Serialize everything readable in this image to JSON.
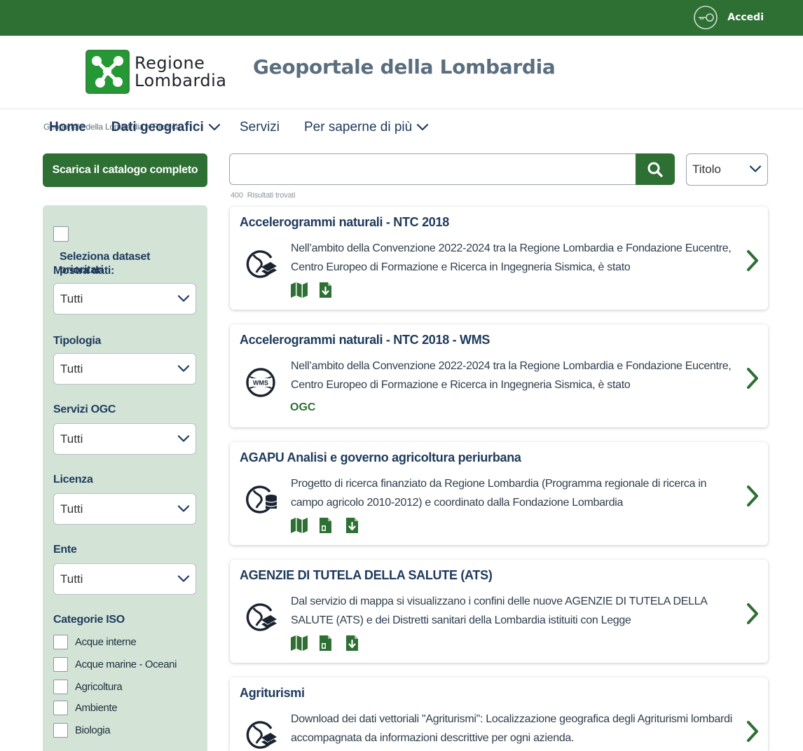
{
  "topbar": {
    "login_label": "Accedi",
    "login_icon": "key-icon",
    "color": "#2e6f34"
  },
  "header": {
    "logo_line1": "Regione",
    "logo_line2": "Lombardia",
    "portal_title": "Geoportale della Lombardia"
  },
  "breadcrumb": "Geoportale della Lombardia > Ricerca",
  "nav": {
    "home": "Home",
    "dati": "Dati geografici",
    "servizi": "Servizi",
    "saperne": "Per saperne di più"
  },
  "catalog_button": "Scarica il catalogo completo",
  "sidebar": {
    "priority_label": "Seleziona dataset prioritari",
    "filters": [
      {
        "label": "Mostra dati:",
        "value": "Tutti"
      },
      {
        "label": "Tipologia",
        "value": "Tutti"
      },
      {
        "label": "Servizi OGC",
        "value": "Tutti"
      },
      {
        "label": "Licenza",
        "value": "Tutti"
      },
      {
        "label": "Ente",
        "value": "Tutti"
      }
    ],
    "iso_title": "Categorie ISO",
    "iso_items": [
      "Acque interne",
      "Acque marine - Oceani",
      "Agricoltura",
      "Ambiente",
      "Biologia"
    ]
  },
  "search": {
    "value": "",
    "sort_value": "Titolo"
  },
  "results": {
    "count": "400",
    "label": "Risultati trovati"
  },
  "cards": [
    {
      "title": "Accelerogrammi naturali - NTC 2018",
      "description": "Nell’ambito della Convenzione 2022-2024 tra la Regione Lombardia e Fondazione Eucentre, Centro Europeo di Formazione e Ricerca in Ingegneria Sismica, è stato",
      "icon": "globe-layers-icon",
      "badges": [
        "map-icon",
        "download-icon"
      ]
    },
    {
      "title": "Accelerogrammi naturali - NTC 2018 - WMS",
      "description": "Nell’ambito della Convenzione 2022-2024 tra la Regione Lombardia e Fondazione Eucentre, Centro Europeo di Formazione e Ricerca in Ingegneria Sismica, è stato",
      "icon": "wms-globe-icon",
      "icon_text": "WMS",
      "ogc_label": "OGC"
    },
    {
      "title": "AGAPU Analisi e governo agricoltura periurbana",
      "description": "Progetto di ricerca finanziato da Regione Lombardia (Programma regionale di ricerca in campo agricolo 2010-2012) e coordinato dalla Fondazione Lombardia",
      "icon": "globe-database-icon",
      "badges": [
        "map-icon",
        "document-icon",
        "download-icon"
      ]
    },
    {
      "title": "AGENZIE DI TUTELA DELLA SALUTE (ATS)",
      "description": "Dal servizio di mappa si visualizzano i confini delle nuove AGENZIE DI TUTELA DELLA SALUTE (ATS) e dei Distretti sanitari della Lombardia istituiti con Legge",
      "icon": "globe-layers-icon",
      "badges": [
        "map-icon",
        "document-icon",
        "download-icon"
      ]
    },
    {
      "title": "Agriturismi",
      "description": "Download dei dati vettoriali \"Agriturismi\": Localizzazione geografica degli Agriturismi lombardi accompagnata da informazioni descrittive per ogni azienda.",
      "icon": "globe-layers-icon"
    }
  ]
}
